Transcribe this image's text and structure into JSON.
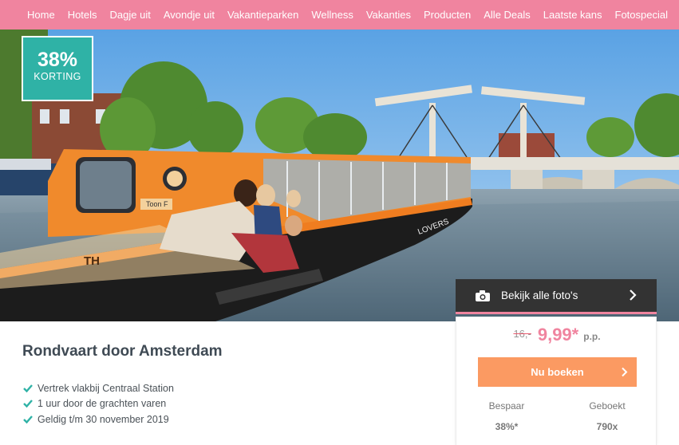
{
  "nav": {
    "items": [
      "Home",
      "Hotels",
      "Dagje uit",
      "Avondje uit",
      "Vakantieparken",
      "Wellness",
      "Vakanties",
      "Producten",
      "Alle Deals",
      "Laatste kans",
      "Fotospecial"
    ]
  },
  "badge": {
    "percent": "38%",
    "label": "KORTING"
  },
  "boat": {
    "marking": "TH",
    "sign_text": "Toon F",
    "brand": "LOVERS"
  },
  "photos_button": {
    "label": "Bekijk alle foto's",
    "icon": "camera-icon"
  },
  "deal": {
    "title": "Rondvaart door Amsterdam",
    "features": [
      "Vertrek vlakbij Centraal Station",
      "1 uur door de grachten varen",
      "Geldig t/m 30 november 2019"
    ]
  },
  "pricing": {
    "old_price": "16,-",
    "new_price": "9,99*",
    "per_person": "p.p.",
    "book_label": "Nu boeken",
    "savings_label": "Bespaar",
    "savings_value": "38%*",
    "booked_label": "Geboekt",
    "booked_value": "790x"
  },
  "colors": {
    "nav": "#f0849f",
    "badge": "#2fb2a6",
    "price": "#f0849f",
    "book_button": "#fb9a62",
    "check": "#2fb2a6"
  }
}
